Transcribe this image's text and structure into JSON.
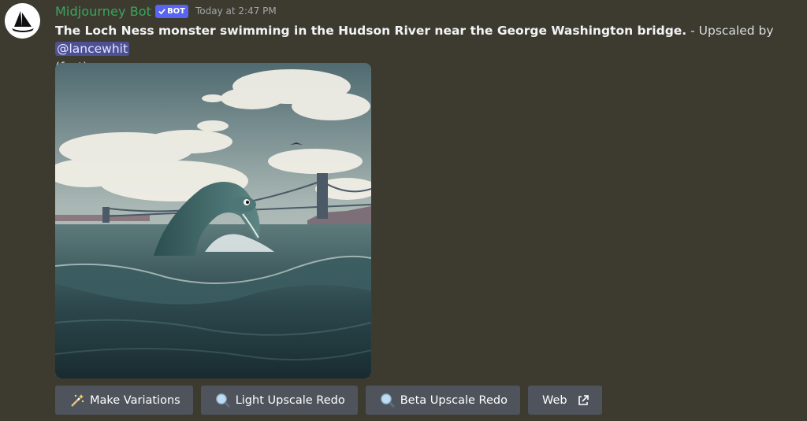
{
  "author": {
    "name": "Midjourney Bot",
    "badge": "BOT",
    "timestamp": "Today at 2:47 PM",
    "avatar_icon": "midjourney-boat-icon"
  },
  "message": {
    "prompt": "The Loch Ness monster swimming in the Hudson River near the George Washington bridge.",
    "separator": " - Upscaled by ",
    "mention": "@lancewhit",
    "mode": "(fast)"
  },
  "attachment": {
    "image_icon": "loch-ness-hudson-image"
  },
  "buttons": [
    {
      "label": "Make Variations",
      "icon": "magic-wand-icon"
    },
    {
      "label": "Light Upscale Redo",
      "icon": "magnifier-icon"
    },
    {
      "label": "Beta Upscale Redo",
      "icon": "magnifier-icon"
    },
    {
      "label": "Web",
      "icon": "external-link-icon"
    }
  ],
  "colors": {
    "background": "#3d3b30",
    "username": "#3ba55d",
    "badge": "#5865f2",
    "button": "#4f545c",
    "mention_bg": "#4e5094"
  }
}
